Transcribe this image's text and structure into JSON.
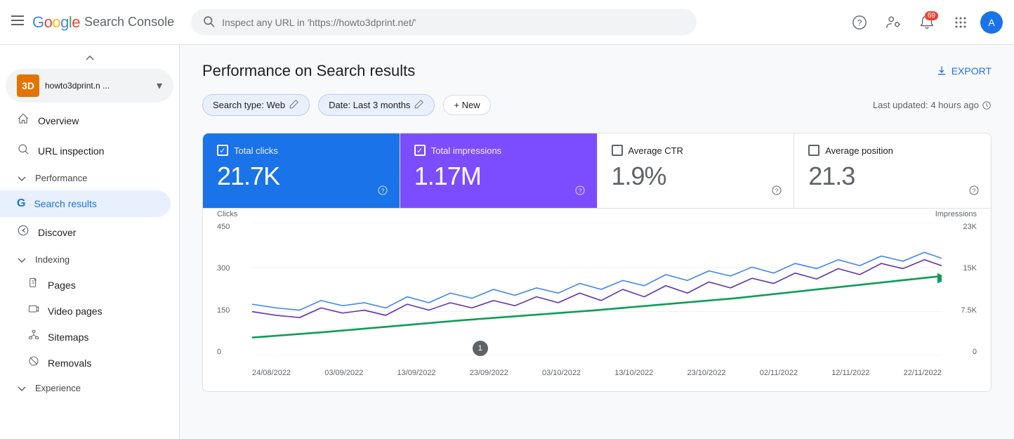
{
  "header": {
    "menu_label": "☰",
    "logo": {
      "google": "Google",
      "product": " Search Console"
    },
    "search_placeholder": "Inspect any URL in 'https://howto3dprint.net/'",
    "actions": {
      "help_icon": "?",
      "accounts_icon": "👤",
      "notifications_icon": "🔔",
      "notifications_badge": "69",
      "apps_icon": "⋮⋮⋮"
    }
  },
  "sidebar": {
    "property": {
      "icon": "3D",
      "name": "howto3dprint.n ...",
      "dropdown": "▾"
    },
    "nav_items": [
      {
        "id": "overview",
        "icon": "🏠",
        "label": "Overview",
        "active": false
      },
      {
        "id": "url-inspection",
        "icon": "🔍",
        "label": "URL inspection",
        "active": false
      }
    ],
    "sections": [
      {
        "id": "performance",
        "label": "Performance",
        "chevron": "▾",
        "items": [
          {
            "id": "search-results",
            "icon": "G",
            "label": "Search results",
            "active": true
          },
          {
            "id": "discover",
            "icon": "✳",
            "label": "Discover",
            "active": false
          }
        ]
      },
      {
        "id": "indexing",
        "label": "Indexing",
        "chevron": "▾",
        "items": [
          {
            "id": "pages",
            "icon": "📄",
            "label": "Pages",
            "active": false
          },
          {
            "id": "video-pages",
            "icon": "🎬",
            "label": "Video pages",
            "active": false
          },
          {
            "id": "sitemaps",
            "icon": "🗺",
            "label": "Sitemaps",
            "active": false
          },
          {
            "id": "removals",
            "icon": "👁",
            "label": "Removals",
            "active": false
          }
        ]
      },
      {
        "id": "experience",
        "label": "Experience",
        "chevron": "▾",
        "items": []
      }
    ]
  },
  "main": {
    "page_title": "Performance on Search results",
    "export_label": "EXPORT",
    "filters": {
      "search_type": "Search type: Web",
      "date": "Date: Last 3 months",
      "new_label": "+ New",
      "last_updated": "Last updated: 4 hours ago"
    },
    "metrics": [
      {
        "id": "total-clicks",
        "label": "Total clicks",
        "value": "21.7K",
        "checked": true,
        "active": "blue",
        "help": "?"
      },
      {
        "id": "total-impressions",
        "label": "Total impressions",
        "value": "1.17M",
        "checked": true,
        "active": "purple",
        "help": "?"
      },
      {
        "id": "average-ctr",
        "label": "Average CTR",
        "value": "1.9%",
        "checked": false,
        "active": "none",
        "help": "?"
      },
      {
        "id": "average-position",
        "label": "Average position",
        "value": "21.3",
        "checked": false,
        "active": "none",
        "help": "?"
      }
    ],
    "chart": {
      "axis_left_label": "Clicks",
      "axis_right_label": "Impressions",
      "y_left": [
        "450",
        "300",
        "150",
        "0"
      ],
      "y_right": [
        "23K",
        "15K",
        "7.5K",
        "0"
      ],
      "x_labels": [
        "24/08/2022",
        "03/09/2022",
        "13/09/2022",
        "23/09/2022",
        "03/10/2022",
        "13/10/2022",
        "23/10/2022",
        "02/11/2022",
        "12/11/2022",
        "22/11/2022"
      ],
      "marker_label": "1"
    }
  }
}
